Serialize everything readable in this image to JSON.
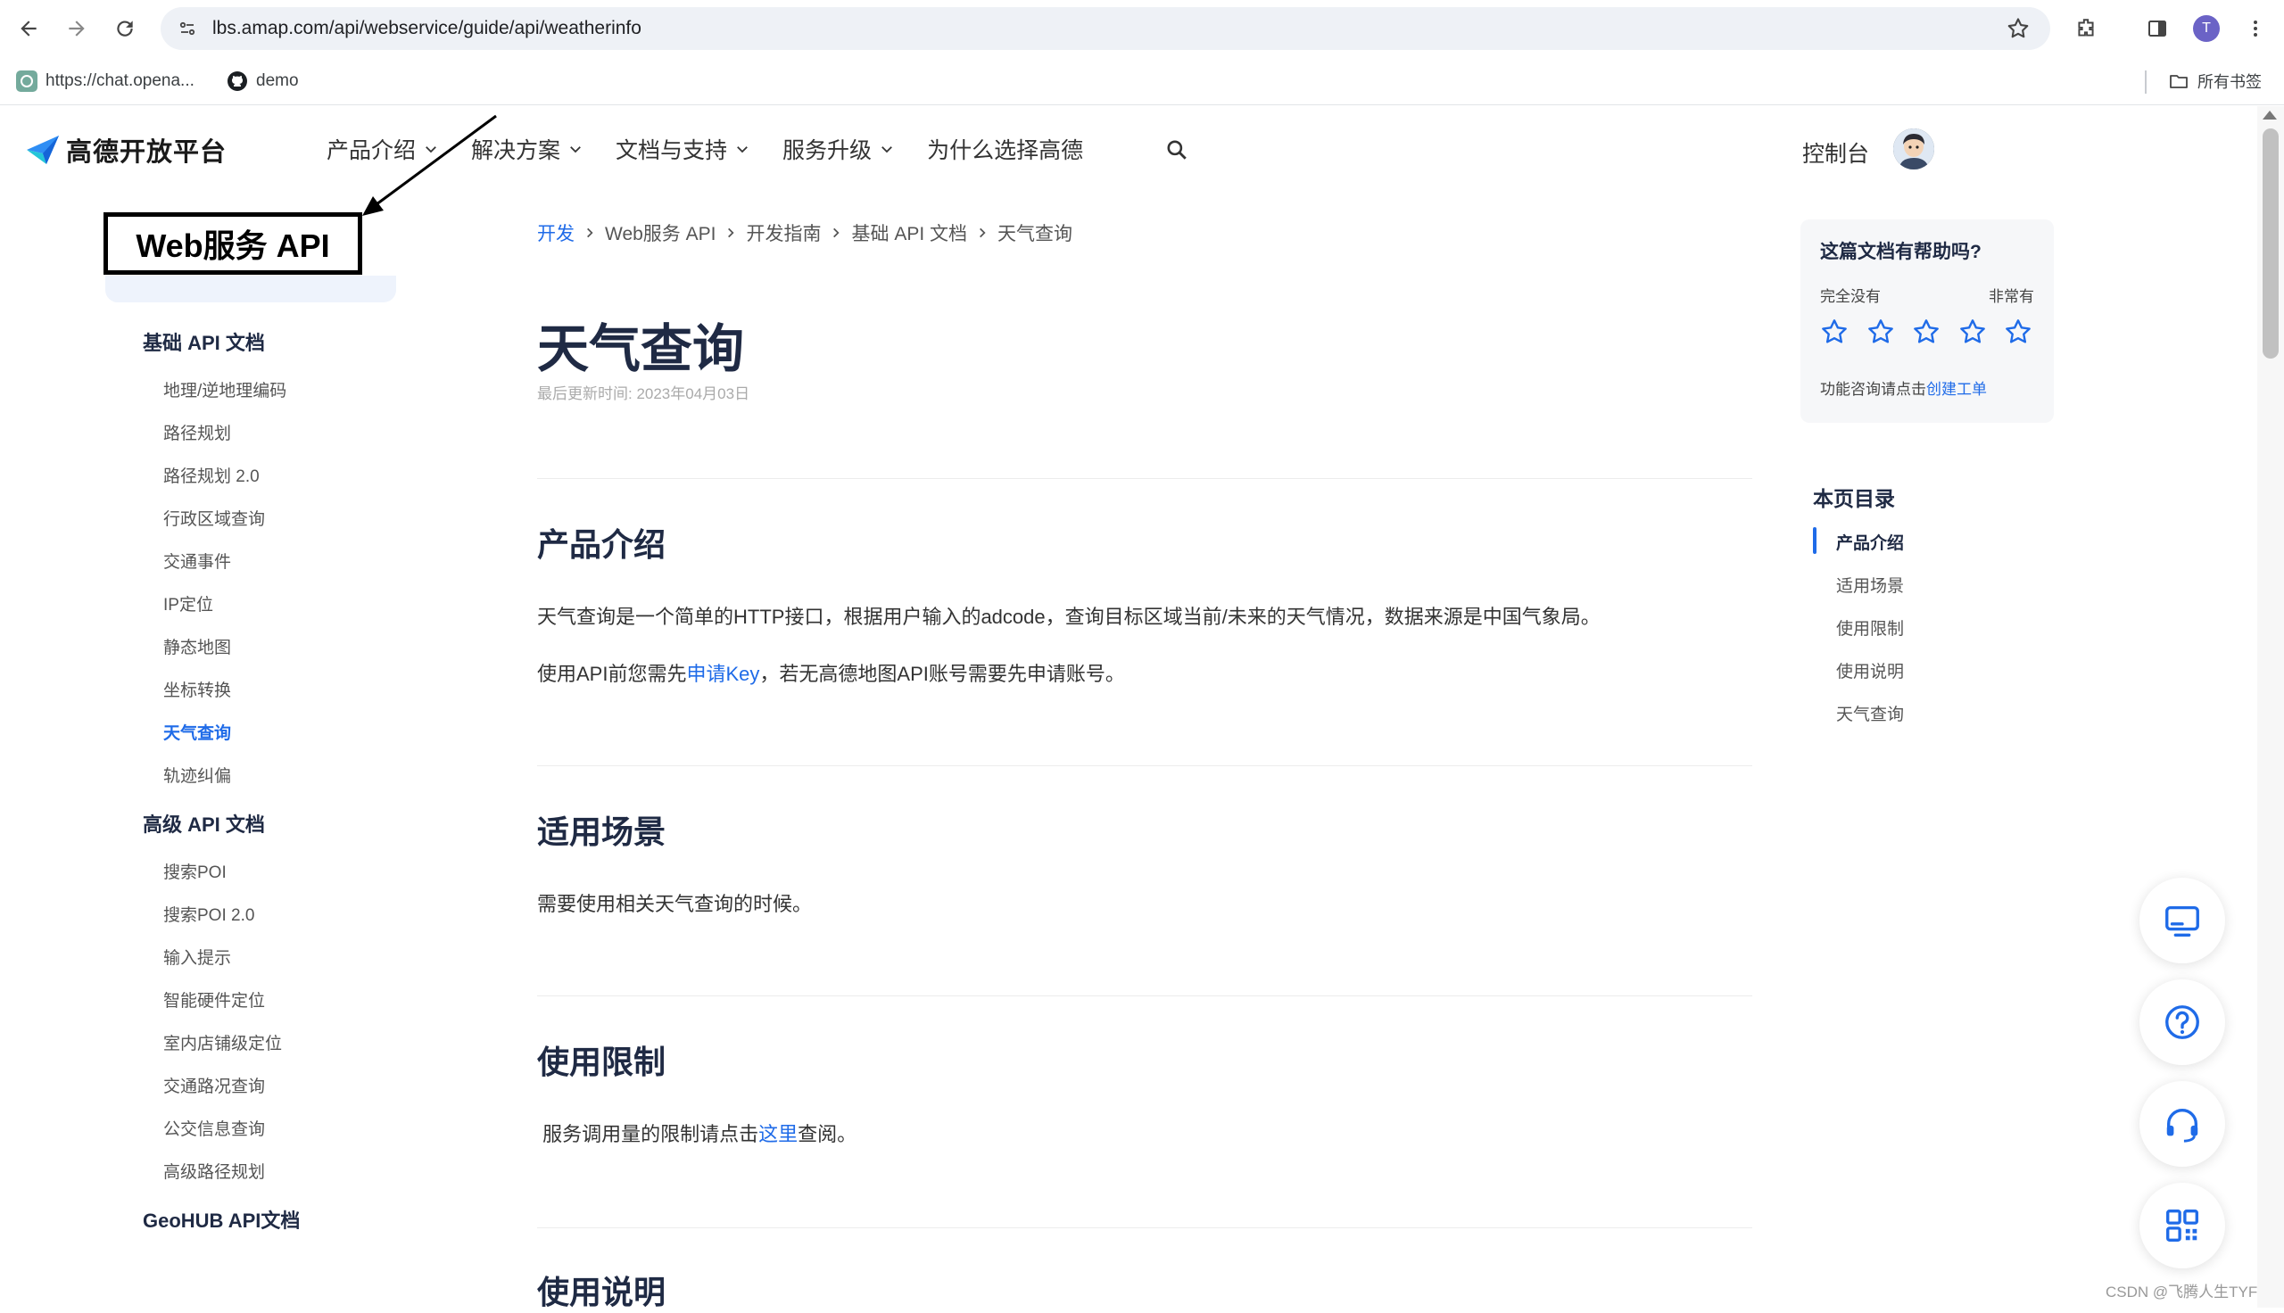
{
  "browser": {
    "url": "lbs.amap.com/api/webservice/guide/api/weatherinfo",
    "profile_initial": "T",
    "bookmarks": [
      {
        "label": "https://chat.opena..."
      },
      {
        "label": "demo"
      }
    ],
    "all_bookmarks_label": "所有书签"
  },
  "header": {
    "logo_text": "高德开放平台",
    "nav": [
      {
        "label": "产品介绍",
        "has_dropdown": true
      },
      {
        "label": "解决方案",
        "has_dropdown": true
      },
      {
        "label": "文档与支持",
        "has_dropdown": true
      },
      {
        "label": "服务升级",
        "has_dropdown": true
      },
      {
        "label": "为什么选择高德",
        "has_dropdown": false
      }
    ],
    "console_label": "控制台"
  },
  "annotation": {
    "label": "Web服务 API"
  },
  "sidebar": {
    "groups": [
      {
        "title": "基础 API 文档",
        "items": [
          "地理/逆地理编码",
          "路径规划",
          "路径规划 2.0",
          "行政区域查询",
          "交通事件",
          "IP定位",
          "静态地图",
          "坐标转换",
          "天气查询",
          "轨迹纠偏"
        ]
      },
      {
        "title": "高级 API 文档",
        "items": [
          "搜索POI",
          "搜索POI 2.0",
          "输入提示",
          "智能硬件定位",
          "室内店铺级定位",
          "交通路况查询",
          "公交信息查询",
          "高级路径规划"
        ]
      },
      {
        "title": "GeoHUB API文档",
        "items": []
      }
    ],
    "active_item": "天气查询"
  },
  "breadcrumb": [
    "开发",
    "Web服务 API",
    "开发指南",
    "基础 API 文档",
    "天气查询"
  ],
  "page": {
    "title": "天气查询",
    "updated": "最后更新时间: 2023年04月03日",
    "sections": [
      {
        "title": "产品介绍",
        "p1": "天气查询是一个简单的HTTP接口，根据用户输入的adcode，查询目标区域当前/未来的天气情况，数据来源是中国气象局。",
        "p2_before": "使用API前您需先",
        "p2_link": "申请Key",
        "p2_after": "，若无高德地图API账号需要先申请账号。"
      },
      {
        "title": "适用场景",
        "p1": "需要使用相关天气查询的时候。"
      },
      {
        "title": "使用限制",
        "p1_before": " 服务调用量的限制请点击",
        "p1_link": "这里",
        "p1_after": "查阅。"
      },
      {
        "title": "使用说明"
      }
    ]
  },
  "feedback": {
    "question": "这篇文档有帮助吗?",
    "low_label": "完全没有",
    "high_label": "非常有",
    "stars": 5,
    "help_text": "功能咨询请点击",
    "help_link": "创建工单"
  },
  "toc": {
    "title": "本页目录",
    "items": [
      "产品介绍",
      "适用场景",
      "使用限制",
      "使用说明",
      "天气查询"
    ],
    "active": "产品介绍"
  },
  "watermark": "CSDN @飞腾人生TYF",
  "colors": {
    "accent": "#1f6be8",
    "heading": "#1f2a44"
  }
}
